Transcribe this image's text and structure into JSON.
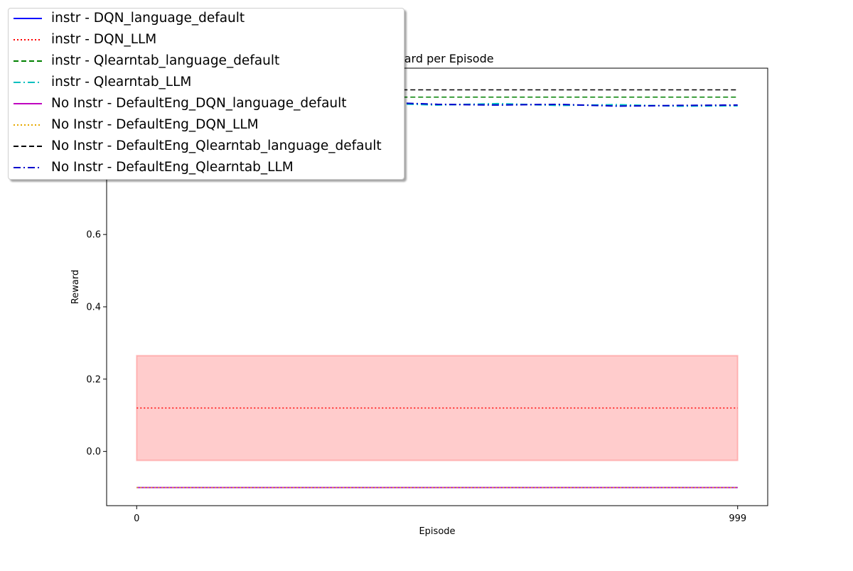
{
  "chart_data": {
    "type": "line",
    "title": "Reward per Episode",
    "xlabel": "Episode",
    "ylabel": "Reward",
    "xlim": [
      -49.95,
      1048.95
    ],
    "ylim": [
      -0.15,
      1.06
    ],
    "xticks": [
      0,
      999
    ],
    "xtick_labels": [
      "0",
      "999"
    ],
    "yticks": [
      0.0,
      0.2,
      0.4,
      0.6
    ],
    "ytick_labels": [
      "0.0",
      "0.2",
      "0.4",
      "0.6"
    ],
    "grid": false,
    "legend_position": "upper-left",
    "series": [
      {
        "name": "instr - DQN_language_default",
        "color": "#0000ff",
        "style": "solid",
        "x": [
          0,
          999
        ],
        "y": [
          -0.1,
          -0.1
        ]
      },
      {
        "name": "instr - DQN_LLM",
        "color": "#ff0000",
        "style": "dotted",
        "x": [
          0,
          999
        ],
        "y": [
          0.12,
          0.12
        ],
        "band": {
          "lower": -0.025,
          "upper": 0.265
        }
      },
      {
        "name": "instr - Qlearntab_language_default",
        "color": "#008000",
        "style": "dashed",
        "x": [
          0,
          999
        ],
        "y": [
          0.98,
          0.98
        ]
      },
      {
        "name": "instr - Qlearntab_LLM",
        "color": "#00bfbf",
        "style": "dashdot",
        "x": [
          0,
          100,
          200,
          300,
          400,
          500,
          600,
          700,
          800,
          900,
          999
        ],
        "y": [
          0.96,
          0.965,
          0.962,
          0.968,
          0.963,
          0.958,
          0.962,
          0.957,
          0.959,
          0.955,
          0.956
        ]
      },
      {
        "name": "No Instr - DefaultEng_DQN_language_default",
        "color": "#bf00bf",
        "style": "solid",
        "x": [
          0,
          999
        ],
        "y": [
          -0.1,
          -0.1
        ]
      },
      {
        "name": "No Instr - DefaultEng_DQN_LLM",
        "color": "#e6a800",
        "style": "dotted",
        "x": [
          0,
          999
        ],
        "y": [
          -0.1,
          -0.1
        ]
      },
      {
        "name": "No Instr - DefaultEng_Qlearntab_language_default",
        "color": "#000000",
        "style": "dashed",
        "x": [
          0,
          999
        ],
        "y": [
          1.0,
          1.0
        ]
      },
      {
        "name": "No Instr - DefaultEng_Qlearntab_LLM",
        "color": "#0000cc",
        "style": "dashdot",
        "x": [
          0,
          100,
          200,
          300,
          400,
          500,
          600,
          700,
          800,
          900,
          999
        ],
        "y": [
          0.955,
          0.958,
          0.95,
          0.962,
          0.966,
          0.96,
          0.958,
          0.96,
          0.955,
          0.957,
          0.958
        ]
      }
    ]
  }
}
